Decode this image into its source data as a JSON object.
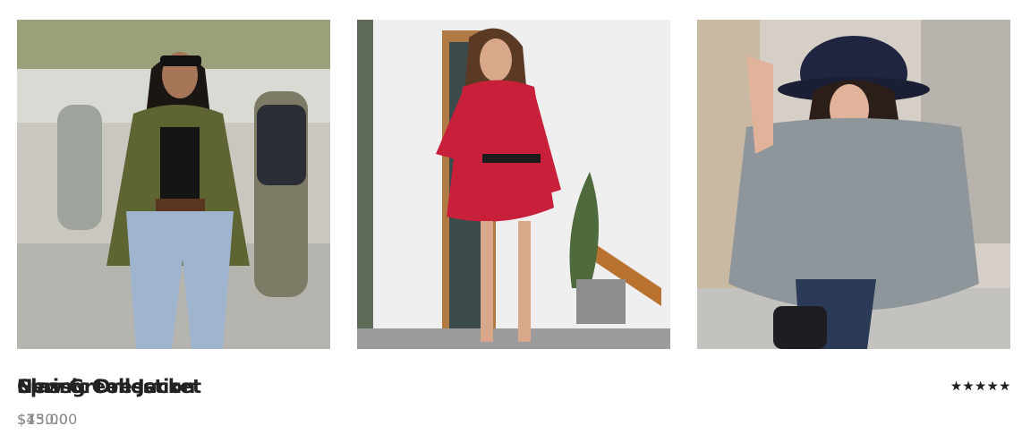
{
  "products": [
    {
      "title": "New Green Jacket",
      "price": "$75.00",
      "rating": 5,
      "image_alt": "Woman in green blazer and jeans walking on street"
    },
    {
      "title": "Classic Dress",
      "price": "$45.00",
      "rating": 5,
      "image_alt": "Woman in red patterned dress"
    },
    {
      "title": "Spring Collection",
      "price": "$130.00",
      "rating": 5,
      "image_alt": "Woman in grey knit poncho and black hat"
    }
  ],
  "star_glyph": "★"
}
